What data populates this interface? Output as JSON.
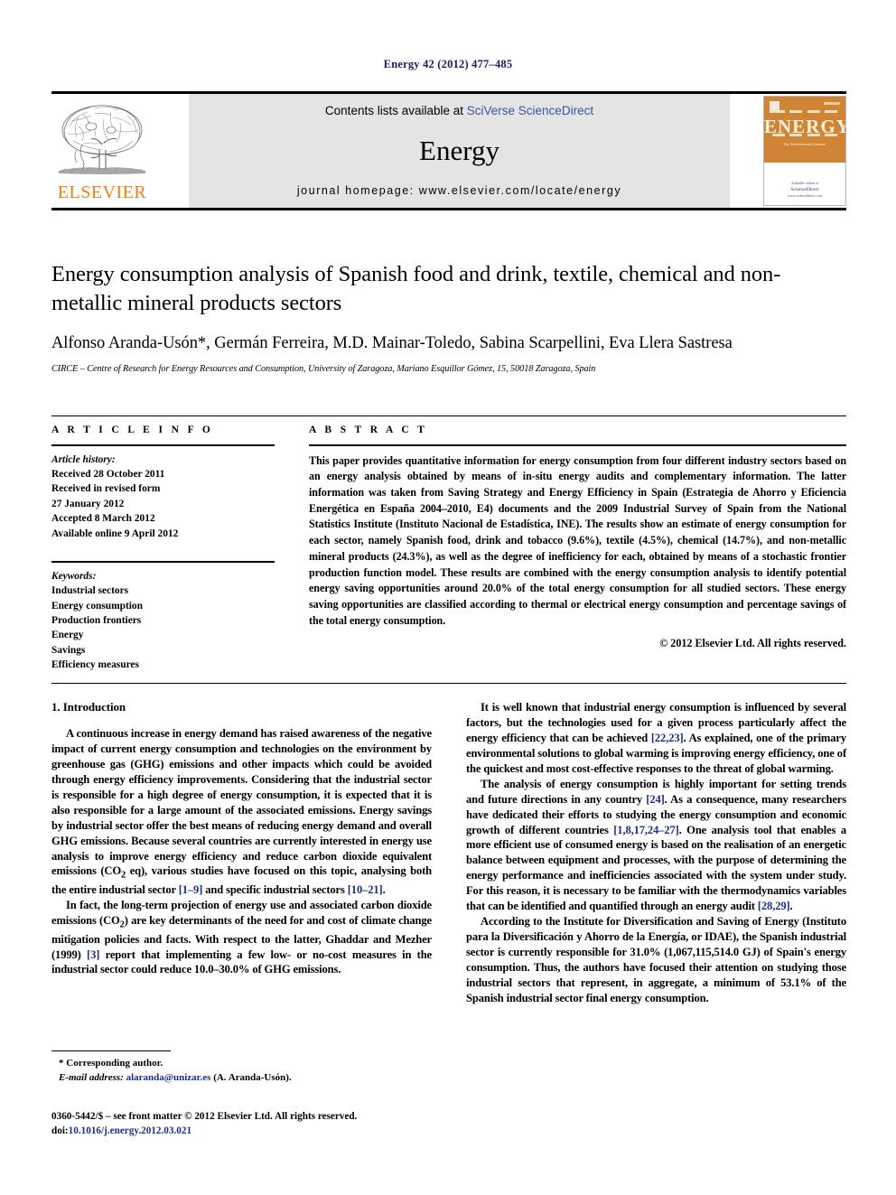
{
  "running_head": "Energy 42 (2012) 477–485",
  "masthead": {
    "publisher": "ELSEVIER",
    "contents_prefix": "Contents lists available at ",
    "contents_link": "SciVerse ScienceDirect",
    "journal_title": "Energy",
    "homepage": "journal homepage: www.elsevier.com/locate/energy",
    "cover": {
      "title": "ENERGY",
      "subtitle": "The International Journal",
      "footer_small": "Available online at",
      "footer_brand": "ScienceDirect",
      "footer_url": "www.sciencedirect.com"
    }
  },
  "article": {
    "title": "Energy consumption analysis of Spanish food and drink, textile, chemical and non-metallic mineral products sectors",
    "authors": "Alfonso Aranda-Usón*, Germán Ferreira, M.D. Mainar-Toledo, Sabina Scarpellini, Eva Llera Sastresa",
    "affiliation": "CIRCE – Centre of Research for Energy Resources and Consumption, University of Zaragoza, Mariano Esquillor Gómez, 15, 50018 Zaragoza, Spain"
  },
  "article_info": {
    "heading": "A R T I C L E   I N F O",
    "history_label": "Article history:",
    "history": [
      "Received 28 October 2011",
      "Received in revised form",
      "27 January 2012",
      "Accepted 8 March 2012",
      "Available online 9 April 2012"
    ],
    "keywords_label": "Keywords:",
    "keywords": [
      "Industrial sectors",
      "Energy consumption",
      "Production frontiers",
      "Energy",
      "Savings",
      "Efficiency measures"
    ]
  },
  "abstract": {
    "heading": "A B S T R A C T",
    "text": "This paper provides quantitative information for energy consumption from four different industry sectors based on an energy analysis obtained by means of in-situ energy audits and complementary information. The latter information was taken from Saving Strategy and Energy Efficiency in Spain (Estrategia de Ahorro y Eficiencia Energética en España 2004–2010, E4) documents and the 2009 Industrial Survey of Spain from the National Statistics Institute (Instituto Nacional de Estadística, INE). The results show an estimate of energy consumption for each sector, namely Spanish food, drink and tobacco (9.6%), textile (4.5%), chemical (14.7%), and non-metallic mineral products (24.3%), as well as the degree of inefficiency for each, obtained by means of a stochastic frontier production function model. These results are combined with the energy consumption analysis to identify potential energy saving opportunities around 20.0% of the total energy consumption for all studied sectors. These energy saving opportunities are classified according to thermal or electrical energy consumption and percentage savings of the total energy consumption.",
    "copyright": "© 2012 Elsevier Ltd. All rights reserved."
  },
  "body": {
    "section_heading": "1. Introduction",
    "left_paragraphs": [
      {
        "segments": [
          {
            "t": "A continuous increase in energy demand has raised awareness of the negative impact of current energy consumption and technologies on the environment by greenhouse gas (GHG) emissions and other impacts which could be avoided through energy efficiency improvements. Considering that the industrial sector is responsible for a high degree of energy consumption, it is expected that it is also responsible for a large amount of the associated emissions. Energy savings by industrial sector offer the best means of reducing energy demand and overall GHG emissions. Because several countries are currently interested in energy use analysis to improve energy efficiency and reduce carbon dioxide equivalent emissions (CO",
            "k": "n"
          },
          {
            "t": "2",
            "k": "sub"
          },
          {
            "t": " eq), various studies have focused on this topic, analysing both the entire industrial sector ",
            "k": "n"
          },
          {
            "t": "[1–9]",
            "k": "ref"
          },
          {
            "t": " and specific industrial sectors ",
            "k": "n"
          },
          {
            "t": "[10–21]",
            "k": "ref"
          },
          {
            "t": ".",
            "k": "n"
          }
        ]
      },
      {
        "segments": [
          {
            "t": "In fact, the long-term projection of energy use and associated carbon dioxide emissions (CO",
            "k": "n"
          },
          {
            "t": "2",
            "k": "sub"
          },
          {
            "t": ") are key determinants of the need for and cost of climate change mitigation policies and facts. With respect to the latter, Ghaddar and Mezher (1999) ",
            "k": "n"
          },
          {
            "t": "[3]",
            "k": "ref"
          },
          {
            "t": " report that implementing a few low- or no-cost measures in the industrial sector could reduce 10.0–30.0% of GHG emissions.",
            "k": "n"
          }
        ]
      }
    ],
    "right_paragraphs": [
      {
        "segments": [
          {
            "t": "It is well known that industrial energy consumption is influenced by several factors, but the technologies used for a given process particularly affect the energy efficiency that can be achieved ",
            "k": "n"
          },
          {
            "t": "[22,23]",
            "k": "ref"
          },
          {
            "t": ". As explained, one of the primary environmental solutions to global warming is improving energy efficiency, one of the quickest and most cost-effective responses to the threat of global warming.",
            "k": "n"
          }
        ]
      },
      {
        "segments": [
          {
            "t": "The analysis of energy consumption is highly important for setting trends and future directions in any country ",
            "k": "n"
          },
          {
            "t": "[24]",
            "k": "ref"
          },
          {
            "t": ". As a consequence, many researchers have dedicated their efforts to studying the energy consumption and economic growth of different countries ",
            "k": "n"
          },
          {
            "t": "[1,8,17,24–27]",
            "k": "ref"
          },
          {
            "t": ". One analysis tool that enables a more efficient use of consumed energy is based on the realisation of an energetic balance between equipment and processes, with the purpose of determining the energy performance and inefficiencies associated with the system under study. For this reason, it is necessary to be familiar with the thermodynamics variables that can be identified and quantified through an energy audit ",
            "k": "n"
          },
          {
            "t": "[28,29]",
            "k": "ref"
          },
          {
            "t": ".",
            "k": "n"
          }
        ]
      },
      {
        "segments": [
          {
            "t": "According to the Institute for Diversification and Saving of Energy (Instituto para la Diversificación y Ahorro de la Energía, or IDAE), the Spanish industrial sector is currently responsible for 31.0% (1,067,115,514.0 GJ) of Spain's energy consumption. Thus, the authors have focused their attention on studying those industrial sectors that represent, in aggregate, a minimum of 53.1% of the Spanish industrial sector final energy consumption.",
            "k": "n"
          }
        ]
      }
    ]
  },
  "footnotes": {
    "corresponding": "* Corresponding author.",
    "email_label": "E-mail address:",
    "email": "alaranda@unizar.es",
    "email_suffix": " (A. Aranda-Usón).",
    "issn_line": "0360-5442/$ – see front matter © 2012 Elsevier Ltd. All rights reserved.",
    "doi_label": "doi:",
    "doi": "10.1016/j.energy.2012.03.021"
  },
  "colors": {
    "running_head": "#1a1a64",
    "link": "#3b53a4",
    "elsevier_orange": "#F07F13",
    "reference": "#1a2f84",
    "panel_gray": "#e4e4e4"
  }
}
